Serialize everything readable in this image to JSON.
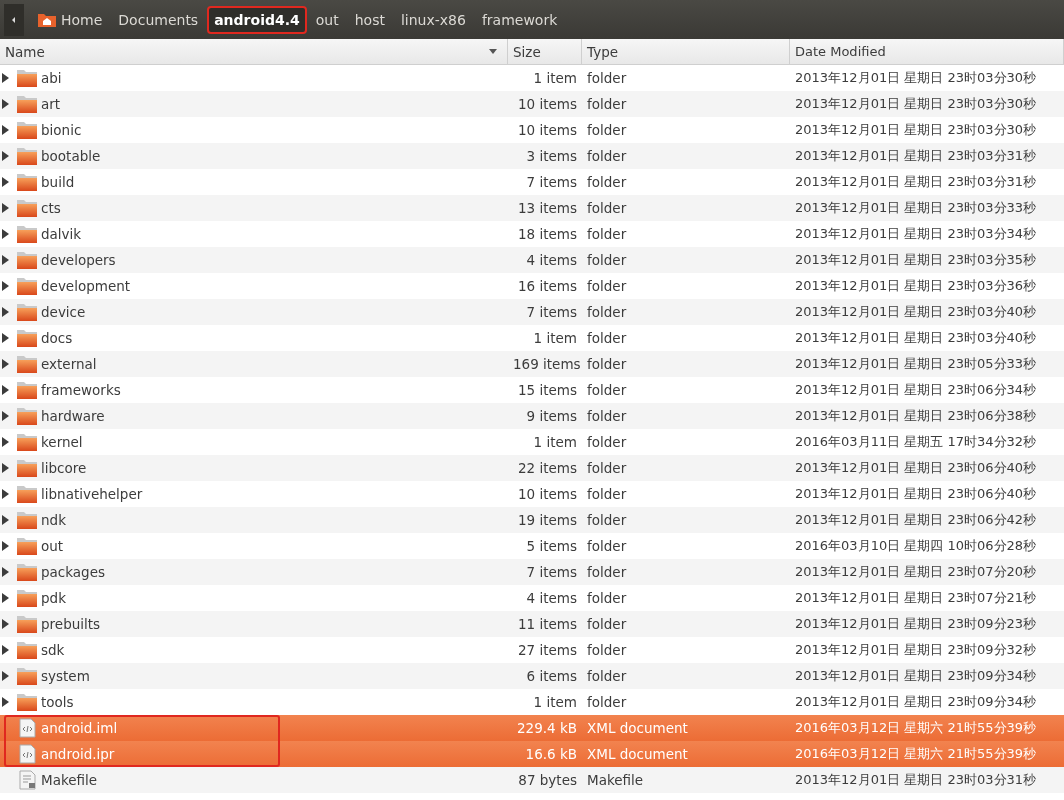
{
  "breadcrumbs": [
    {
      "label": "Home",
      "kind": "home",
      "selected": false,
      "marked": false
    },
    {
      "label": "Documents",
      "kind": "plain",
      "selected": false,
      "marked": false
    },
    {
      "label": "android4.4",
      "kind": "plain",
      "selected": true,
      "marked": true
    },
    {
      "label": "out",
      "kind": "plain",
      "selected": false,
      "marked": false
    },
    {
      "label": "host",
      "kind": "plain",
      "selected": false,
      "marked": false
    },
    {
      "label": "linux-x86",
      "kind": "plain",
      "selected": false,
      "marked": false
    },
    {
      "label": "framework",
      "kind": "plain",
      "selected": false,
      "marked": false
    }
  ],
  "columns": [
    "Name",
    "Size",
    "Type",
    "Date Modified"
  ],
  "rows": [
    {
      "name": "abi",
      "size": "1 item",
      "type": "folder",
      "date": "2013年12月01日 星期日 23时03分30秒",
      "kind": "folder",
      "selected": false,
      "marked": false
    },
    {
      "name": "art",
      "size": "10 items",
      "type": "folder",
      "date": "2013年12月01日 星期日 23时03分30秒",
      "kind": "folder",
      "selected": false,
      "marked": false
    },
    {
      "name": "bionic",
      "size": "10 items",
      "type": "folder",
      "date": "2013年12月01日 星期日 23时03分30秒",
      "kind": "folder",
      "selected": false,
      "marked": false
    },
    {
      "name": "bootable",
      "size": "3 items",
      "type": "folder",
      "date": "2013年12月01日 星期日 23时03分31秒",
      "kind": "folder",
      "selected": false,
      "marked": false
    },
    {
      "name": "build",
      "size": "7 items",
      "type": "folder",
      "date": "2013年12月01日 星期日 23时03分31秒",
      "kind": "folder",
      "selected": false,
      "marked": false
    },
    {
      "name": "cts",
      "size": "13 items",
      "type": "folder",
      "date": "2013年12月01日 星期日 23时03分33秒",
      "kind": "folder",
      "selected": false,
      "marked": false
    },
    {
      "name": "dalvik",
      "size": "18 items",
      "type": "folder",
      "date": "2013年12月01日 星期日 23时03分34秒",
      "kind": "folder",
      "selected": false,
      "marked": false
    },
    {
      "name": "developers",
      "size": "4 items",
      "type": "folder",
      "date": "2013年12月01日 星期日 23时03分35秒",
      "kind": "folder",
      "selected": false,
      "marked": false
    },
    {
      "name": "development",
      "size": "16 items",
      "type": "folder",
      "date": "2013年12月01日 星期日 23时03分36秒",
      "kind": "folder",
      "selected": false,
      "marked": false
    },
    {
      "name": "device",
      "size": "7 items",
      "type": "folder",
      "date": "2013年12月01日 星期日 23时03分40秒",
      "kind": "folder",
      "selected": false,
      "marked": false
    },
    {
      "name": "docs",
      "size": "1 item",
      "type": "folder",
      "date": "2013年12月01日 星期日 23时03分40秒",
      "kind": "folder",
      "selected": false,
      "marked": false
    },
    {
      "name": "external",
      "size": "169 items",
      "type": "folder",
      "date": "2013年12月01日 星期日 23时05分33秒",
      "kind": "folder",
      "selected": false,
      "marked": false
    },
    {
      "name": "frameworks",
      "size": "15 items",
      "type": "folder",
      "date": "2013年12月01日 星期日 23时06分34秒",
      "kind": "folder",
      "selected": false,
      "marked": false
    },
    {
      "name": "hardware",
      "size": "9 items",
      "type": "folder",
      "date": "2013年12月01日 星期日 23时06分38秒",
      "kind": "folder",
      "selected": false,
      "marked": false
    },
    {
      "name": "kernel",
      "size": "1 item",
      "type": "folder",
      "date": "2016年03月11日 星期五 17时34分32秒",
      "kind": "folder",
      "selected": false,
      "marked": false
    },
    {
      "name": "libcore",
      "size": "22 items",
      "type": "folder",
      "date": "2013年12月01日 星期日 23时06分40秒",
      "kind": "folder",
      "selected": false,
      "marked": false
    },
    {
      "name": "libnativehelper",
      "size": "10 items",
      "type": "folder",
      "date": "2013年12月01日 星期日 23时06分40秒",
      "kind": "folder",
      "selected": false,
      "marked": false
    },
    {
      "name": "ndk",
      "size": "19 items",
      "type": "folder",
      "date": "2013年12月01日 星期日 23时06分42秒",
      "kind": "folder",
      "selected": false,
      "marked": false
    },
    {
      "name": "out",
      "size": "5 items",
      "type": "folder",
      "date": "2016年03月10日 星期四 10时06分28秒",
      "kind": "folder",
      "selected": false,
      "marked": false
    },
    {
      "name": "packages",
      "size": "7 items",
      "type": "folder",
      "date": "2013年12月01日 星期日 23时07分20秒",
      "kind": "folder",
      "selected": false,
      "marked": false
    },
    {
      "name": "pdk",
      "size": "4 items",
      "type": "folder",
      "date": "2013年12月01日 星期日 23时07分21秒",
      "kind": "folder",
      "selected": false,
      "marked": false
    },
    {
      "name": "prebuilts",
      "size": "11 items",
      "type": "folder",
      "date": "2013年12月01日 星期日 23时09分23秒",
      "kind": "folder",
      "selected": false,
      "marked": false
    },
    {
      "name": "sdk",
      "size": "27 items",
      "type": "folder",
      "date": "2013年12月01日 星期日 23时09分32秒",
      "kind": "folder",
      "selected": false,
      "marked": false
    },
    {
      "name": "system",
      "size": "6 items",
      "type": "folder",
      "date": "2013年12月01日 星期日 23时09分34秒",
      "kind": "folder",
      "selected": false,
      "marked": false
    },
    {
      "name": "tools",
      "size": "1 item",
      "type": "folder",
      "date": "2013年12月01日 星期日 23时09分34秒",
      "kind": "folder",
      "selected": false,
      "marked": false
    },
    {
      "name": "android.iml",
      "size": "229.4 kB",
      "type": "XML document",
      "date": "2016年03月12日 星期六 21时55分39秒",
      "kind": "xml",
      "selected": true,
      "marked": true
    },
    {
      "name": "android.ipr",
      "size": "16.6 kB",
      "type": "XML document",
      "date": "2016年03月12日 星期六 21时55分39秒",
      "kind": "xml",
      "selected": true,
      "marked": true
    },
    {
      "name": "Makefile",
      "size": "87 bytes",
      "type": "Makefile",
      "date": "2013年12月01日 星期日 23时03分31秒",
      "kind": "text",
      "selected": false,
      "marked": false
    }
  ]
}
